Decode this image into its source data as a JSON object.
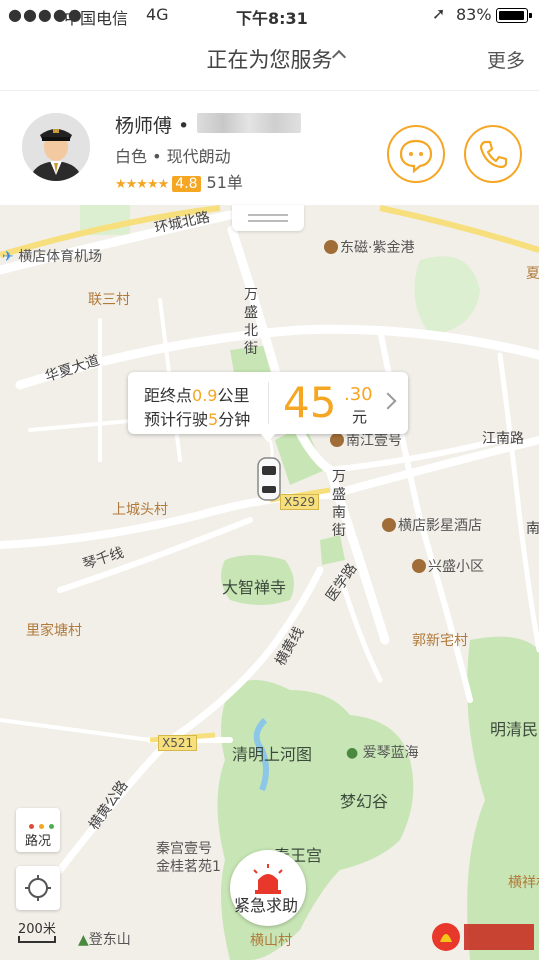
{
  "status_bar": {
    "signal": "●●●●●",
    "carrier": "中国电信",
    "network": "4G",
    "time": "下午8:31",
    "battery": "83%"
  },
  "nav": {
    "title": "正在为您服务",
    "more": "更多"
  },
  "driver": {
    "name": "杨师傅 •",
    "car": "白色 • 现代朗动",
    "stars": "★★★★★",
    "rating": "4.8",
    "orders": "51单"
  },
  "trip": {
    "distance_prefix": "距终点",
    "distance_value": "0.9",
    "distance_unit": "公里",
    "eta_prefix": "预计行驶",
    "eta_value": "5",
    "eta_unit": "分钟",
    "fare_main": "45",
    "fare_cents": ".30",
    "fare_unit": "元"
  },
  "map": {
    "labels": {
      "huancheng_bei_lu": "环城北路",
      "hengdian_airport": "横店体育机场",
      "dongci_zijin": "东磁·紫金港",
      "xia": "夏",
      "liansan_cun": "联三村",
      "wansheng_bei_jie": "万盛北街",
      "huaxia_dadao": "华夏大道",
      "nanjiang_yihao": "南江壹号",
      "jiangnan_lu": "江南路",
      "shangchengtou_cun": "上城头村",
      "x529": "X529",
      "wansheng_nan_jie": "万盛南街",
      "hengdian_yingxing": "横店影星酒店",
      "qinqian_xian": "琴千线",
      "xingsheng_xiaoqu": "兴盛小区",
      "dazhi_chansi": "大智禅寺",
      "yixue_lu": "医学路",
      "lijiatang_cun": "里家塘村",
      "guoxinzhai_cun": "郭新宅村",
      "henghuang_xian": "横黄线",
      "mingqingmin": "明清民",
      "x521": "X521",
      "qingming": "清明上河图",
      "aiqin_lanhai": "爱琴蓝海",
      "menghuan_gu": "梦幻谷",
      "henghuang_gonglu": "横黄公路",
      "qingong_yihao": "秦宫壹号",
      "jingui_mingyuan": "金桂茗苑1",
      "qinwang_gong": "秦王宫",
      "denglongshan": "登东山",
      "hengshan_cun": "横山村",
      "hengxiang_cun": "横祥村",
      "side_street": "南"
    },
    "traffic": "路况",
    "sos": "紧急求助",
    "scale": "200米"
  },
  "colors": {
    "accent": "#f5a623",
    "park": "#c8e6b5",
    "road": "#ffffff",
    "highway": "#f6df7c"
  }
}
